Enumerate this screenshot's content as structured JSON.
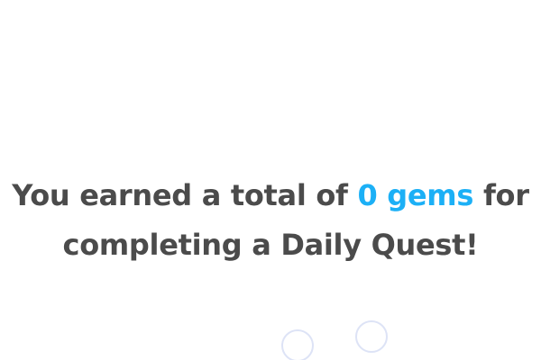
{
  "message": {
    "line1_before": "You earned a total of",
    "highlight": "0 gems",
    "line1_after": "for",
    "line2": "completing a Daily Quest!"
  },
  "colors": {
    "text": "#4b4b4b",
    "accent": "#1cb0f6",
    "ring": "#dde3f6",
    "background": "#ffffff"
  },
  "icons": [
    "ring-icon",
    "ring-icon"
  ]
}
